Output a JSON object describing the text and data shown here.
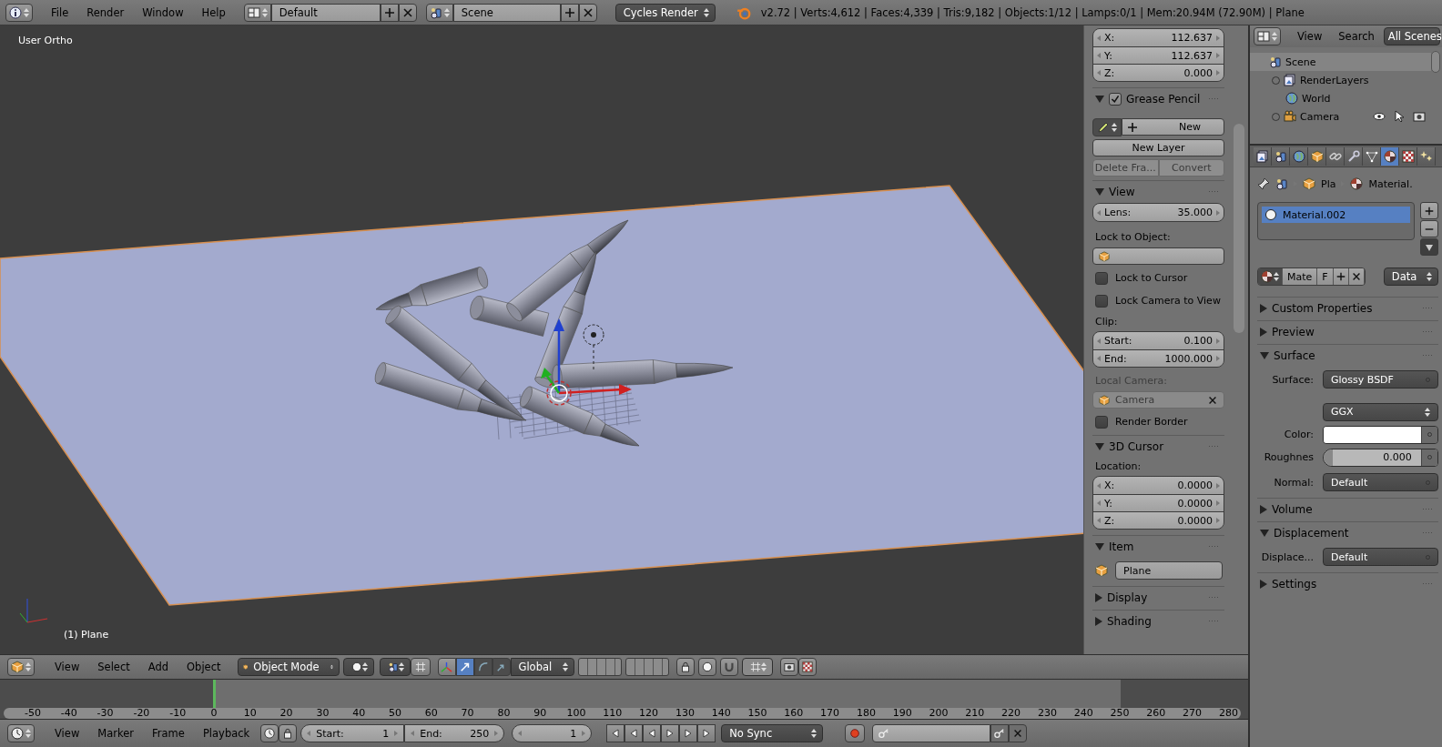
{
  "top_bar": {
    "menus": [
      "File",
      "Render",
      "Window",
      "Help"
    ],
    "layout": "Default",
    "scene": "Scene",
    "engine": "Cycles Render",
    "stats": "v2.72 | Verts:4,612 | Faces:4,339 | Tris:9,182 | Objects:1/12 | Lamps:0/1 | Mem:20.94M (72.90M) | Plane"
  },
  "viewport": {
    "view_name": "User Ortho",
    "object_name": "(1) Plane"
  },
  "n_panel": [
    {
      "kind": "vector",
      "fields": [
        {
          "label": "X:",
          "value": "112.637"
        },
        {
          "label": "Y:",
          "value": "112.637"
        },
        {
          "label": "Z:",
          "value": "0.000"
        }
      ]
    },
    {
      "kind": "panel",
      "title": "Grease Pencil",
      "expanded": true,
      "checked": true
    },
    {
      "kind": "new",
      "label": "New"
    },
    {
      "kind": "button",
      "label": "New Layer"
    },
    {
      "kind": "pair",
      "labels": [
        "Delete Fra...",
        "Convert"
      ],
      "disabled": true
    },
    {
      "kind": "panel",
      "title": "View",
      "expanded": true
    },
    {
      "kind": "vector",
      "fields": [
        {
          "label": "Lens:",
          "value": "35.000"
        }
      ]
    },
    {
      "kind": "label",
      "text": "Lock to Object:",
      "disabled": false
    },
    {
      "kind": "object"
    },
    {
      "kind": "checkbox",
      "label": "Lock to Cursor",
      "checked": false
    },
    {
      "kind": "checkbox",
      "label": "Lock Camera to View",
      "checked": false
    },
    {
      "kind": "label",
      "text": "Clip:",
      "disabled": false
    },
    {
      "kind": "vector",
      "fields": [
        {
          "label": "Start:",
          "value": "0.100"
        },
        {
          "label": "End:",
          "value": "1000.000"
        }
      ]
    },
    {
      "kind": "label",
      "text": "Local Camera:",
      "disabled": true
    },
    {
      "kind": "object",
      "value": "Camera",
      "disabled": true
    },
    {
      "kind": "checkbox",
      "label": "Render Border",
      "checked": false
    },
    {
      "kind": "panel",
      "title": "3D Cursor",
      "expanded": true
    },
    {
      "kind": "label",
      "text": "Location:",
      "disabled": false
    },
    {
      "kind": "vector",
      "fields": [
        {
          "label": "X:",
          "value": "0.0000"
        },
        {
          "label": "Y:",
          "value": "0.0000"
        },
        {
          "label": "Z:",
          "value": "0.0000"
        }
      ]
    },
    {
      "kind": "panel",
      "title": "Item",
      "expanded": true
    },
    {
      "kind": "name",
      "value": "Plane"
    },
    {
      "kind": "panel",
      "title": "Display",
      "expanded": false
    },
    {
      "kind": "panel",
      "title": "Shading",
      "expanded": false
    }
  ],
  "outliner": {
    "menus": [
      "View",
      "Search"
    ],
    "filter": "All Scenes",
    "tree": [
      {
        "name": "Scene",
        "kind": "scene",
        "selected": true,
        "children": [
          {
            "name": "RenderLayers",
            "kind": "renderlayers",
            "selected": false,
            "expanded": false
          },
          {
            "name": "World",
            "kind": "world",
            "selected": false
          },
          {
            "name": "Camera",
            "kind": "camera",
            "selected": false,
            "expanded": false
          }
        ]
      }
    ]
  },
  "properties": {
    "tabs": [
      {
        "kind": "renderlayers",
        "selected": false
      },
      {
        "kind": "scene",
        "selected": false
      },
      {
        "kind": "world",
        "selected": false
      },
      {
        "kind": "object",
        "selected": false
      },
      {
        "kind": "constraints",
        "selected": false
      },
      {
        "kind": "modifiers",
        "selected": false
      },
      {
        "kind": "data",
        "selected": false
      },
      {
        "kind": "material",
        "selected": true
      },
      {
        "kind": "texture",
        "selected": false
      },
      {
        "kind": "particles",
        "selected": false
      }
    ],
    "breadcrumb": [
      {
        "kind": "object",
        "text": "Pla"
      },
      {
        "kind": "material",
        "text": "Material."
      }
    ],
    "slots": [
      {
        "name": "Material.002",
        "selected": true
      }
    ],
    "datablock": {
      "name": "Mate",
      "users": "F",
      "link": "Data"
    },
    "rows": [
      {
        "kind": "panel",
        "title": "Custom Properties",
        "expanded": false
      },
      {
        "kind": "panel",
        "title": "Preview",
        "expanded": false
      },
      {
        "kind": "panel",
        "title": "Surface",
        "expanded": true
      },
      {
        "kind": "socket",
        "label": "Surface:",
        "value": "Glossy BSDF"
      },
      {
        "kind": "enum",
        "value": "GGX"
      },
      {
        "kind": "color",
        "label": "Color:",
        "color": "#ffffff"
      },
      {
        "kind": "slider",
        "label": "Roughnes",
        "value": "0.000",
        "level": 0
      },
      {
        "kind": "socket",
        "label": "Normal:",
        "value": "Default"
      },
      {
        "kind": "panel",
        "title": "Volume",
        "expanded": false
      },
      {
        "kind": "panel",
        "title": "Displacement",
        "expanded": true
      },
      {
        "kind": "socket",
        "label": "Displace...",
        "value": "Default"
      },
      {
        "kind": "panel",
        "title": "Settings",
        "expanded": false
      }
    ]
  },
  "view_header": {
    "menus": [
      "View",
      "Select",
      "Add",
      "Object"
    ],
    "mode": "Object Mode",
    "orientation": "Global"
  },
  "timeline": {
    "ticks": [
      "-50",
      "-40",
      "-30",
      "-20",
      "-10",
      "0",
      "10",
      "20",
      "30",
      "40",
      "50",
      "60",
      "70",
      "80",
      "90",
      "100",
      "110",
      "120",
      "130",
      "140",
      "150",
      "160",
      "170",
      "180",
      "190",
      "200",
      "210",
      "220",
      "230",
      "240",
      "250",
      "260",
      "270",
      "280"
    ]
  },
  "timeline_header": {
    "menus": [
      "View",
      "Marker",
      "Frame",
      "Playback"
    ],
    "start_label": "Start:",
    "start": "1",
    "end_label": "End:",
    "end": "250",
    "current": "1",
    "sync": "No Sync"
  }
}
